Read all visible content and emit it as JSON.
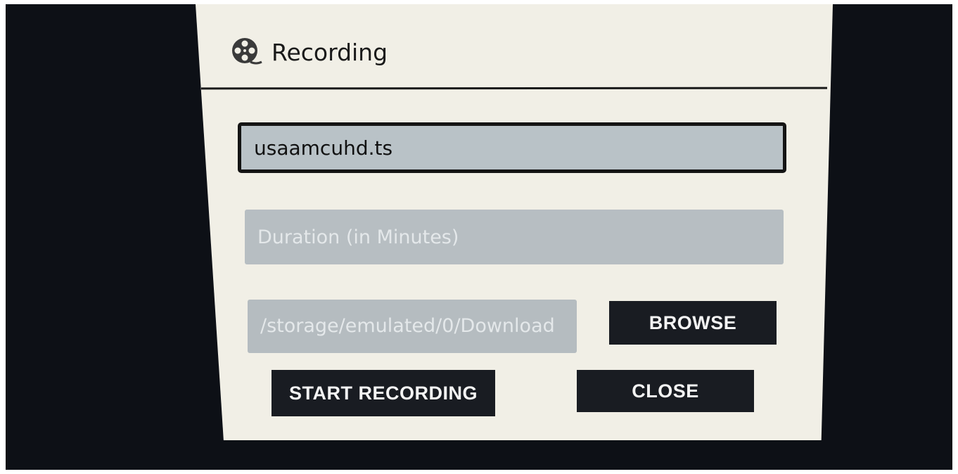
{
  "dialog": {
    "title": "Recording",
    "title_icon": "film-reel-icon"
  },
  "form": {
    "filename_value": "usaamcuhd.ts",
    "duration_placeholder": "Duration (in Minutes)",
    "duration_value": "",
    "save_path": "/storage/emulated/0/Download"
  },
  "buttons": {
    "browse_label": "BROWSE",
    "start_recording_label": "START RECORDING",
    "close_label": "CLOSE"
  },
  "colors": {
    "dialog_background": "#f1efe6",
    "button_background": "#191c22",
    "field_background": "#b9c2c7",
    "screen_background": "#0d1016"
  }
}
